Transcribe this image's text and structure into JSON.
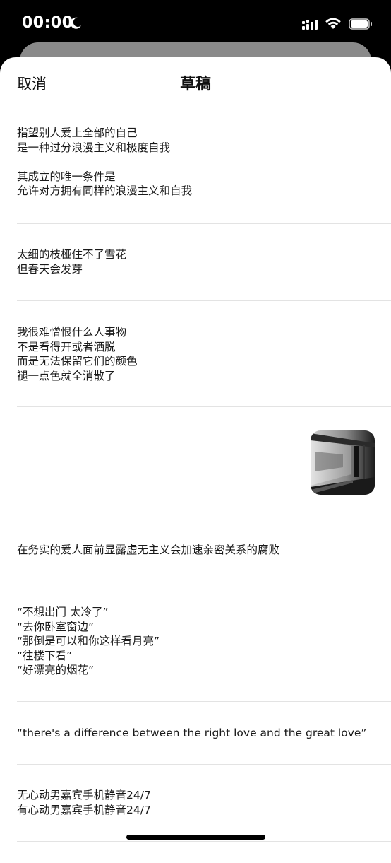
{
  "status_bar": {
    "time": "00:00"
  },
  "nav": {
    "cancel_label": "取消",
    "title": "草稿"
  },
  "drafts": [
    {
      "lines": [
        "指望别人爱上全部的自己",
        "是一种过分浪漫主义和极度自我",
        "",
        "其成立的唯一条件是",
        "允许对方拥有同样的浪漫主义和自我"
      ]
    },
    {
      "lines": [
        "太细的枝桠住不了雪花",
        "但春天会发芽"
      ]
    },
    {
      "lines": [
        "我很难憎恨什么人事物",
        "不是看得开或者洒脱",
        "而是无法保留它们的颜色",
        "褪一点色就全消散了"
      ]
    },
    {
      "image": "train-window-blurred-photo"
    },
    {
      "lines": [
        "在务实的爱人面前显露虚无主义会加速亲密关系的腐败"
      ]
    },
    {
      "lines": [
        "“不想出门 太冷了”",
        "“去你卧室窗边”",
        "“那倒是可以和你这样看月亮”",
        "“往楼下看”",
        "“好漂亮的烟花”"
      ]
    },
    {
      "lines": [
        "“there's a difference between the right love and the great love”"
      ]
    },
    {
      "lines": [
        "无心动男嘉宾手机静音24/7",
        "有心动男嘉宾手机静音24/7"
      ]
    }
  ],
  "colors": {
    "sheet": "#ffffff",
    "background": "#000000",
    "back_sheet": "#8a8a8a",
    "divider": "#e3e3e3"
  }
}
